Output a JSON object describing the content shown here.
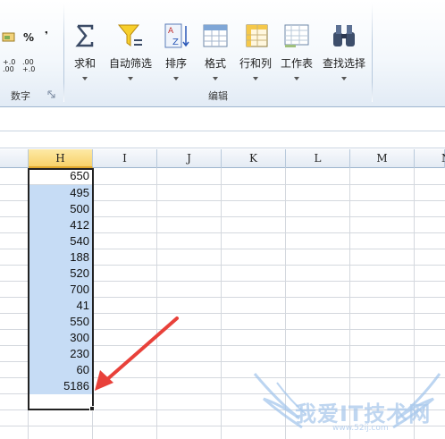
{
  "ribbon": {
    "number_group": {
      "label": "数字",
      "percent": "%",
      "comma": "❜",
      "inc_decimal": "+.0\n.00",
      "dec_decimal": ".00\n+.0"
    },
    "edit_group": {
      "label": "编辑",
      "buttons": [
        {
          "label": "求和"
        },
        {
          "label": "自动筛选"
        },
        {
          "label": "排序"
        },
        {
          "label": "格式"
        },
        {
          "label": "行和列"
        },
        {
          "label": "工作表"
        },
        {
          "label": "查找选择"
        }
      ]
    }
  },
  "sheet": {
    "columns": [
      "H",
      "I",
      "J",
      "K",
      "L",
      "M",
      "N"
    ],
    "selected_column": "H",
    "values": [
      "650",
      "495",
      "500",
      "412",
      "540",
      "188",
      "520",
      "700",
      "41",
      "550",
      "300",
      "230",
      "60",
      "5186"
    ]
  },
  "watermark": {
    "text": "我爱IT技术网",
    "sub": "www.52ij.com"
  },
  "colors": {
    "selection_fill": "#c6dcf5",
    "header_selected": "#f8d26a",
    "arrow": "#e8413a"
  }
}
